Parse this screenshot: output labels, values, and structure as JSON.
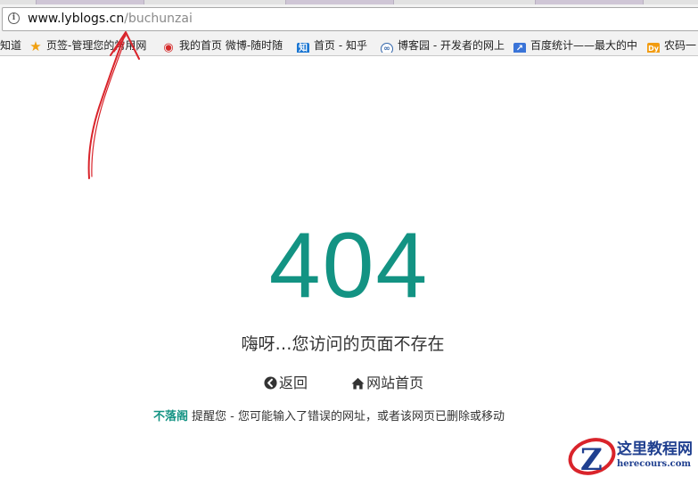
{
  "browser": {
    "url_host": "www.lyblogs.cn",
    "url_path": "/buchunzai",
    "bookmarks": [
      {
        "label": "知道",
        "icon": "none"
      },
      {
        "label": "页签-管理您的常用网",
        "icon": "star-icon"
      },
      {
        "label": "我的首页 微博-随时随",
        "icon": "weibo-icon"
      },
      {
        "label": "首页 - 知乎",
        "icon": "zhihu-icon",
        "glyph": "知"
      },
      {
        "label": "博客园 - 开发者的网上",
        "icon": "cnblogs-icon"
      },
      {
        "label": "百度统计——最大的中",
        "icon": "baidu-tongji-icon"
      },
      {
        "label": "农码一",
        "icon": "nonglu-icon",
        "glyph": "Dy"
      }
    ]
  },
  "error": {
    "code": "404",
    "message": "嗨呀…您访问的页面不存在",
    "back_label": "返回",
    "home_label": "网站首页",
    "note_brand": "不落阁",
    "note_text": "提醒您 - 您可能输入了错误的网址，或者该网页已删除或移动"
  },
  "watermark": {
    "name": "这里教程网",
    "domain": "herecours.com"
  },
  "colors": {
    "accent": "#139383",
    "annotation": "#d9242b",
    "watermark": "#1f3f8f"
  }
}
